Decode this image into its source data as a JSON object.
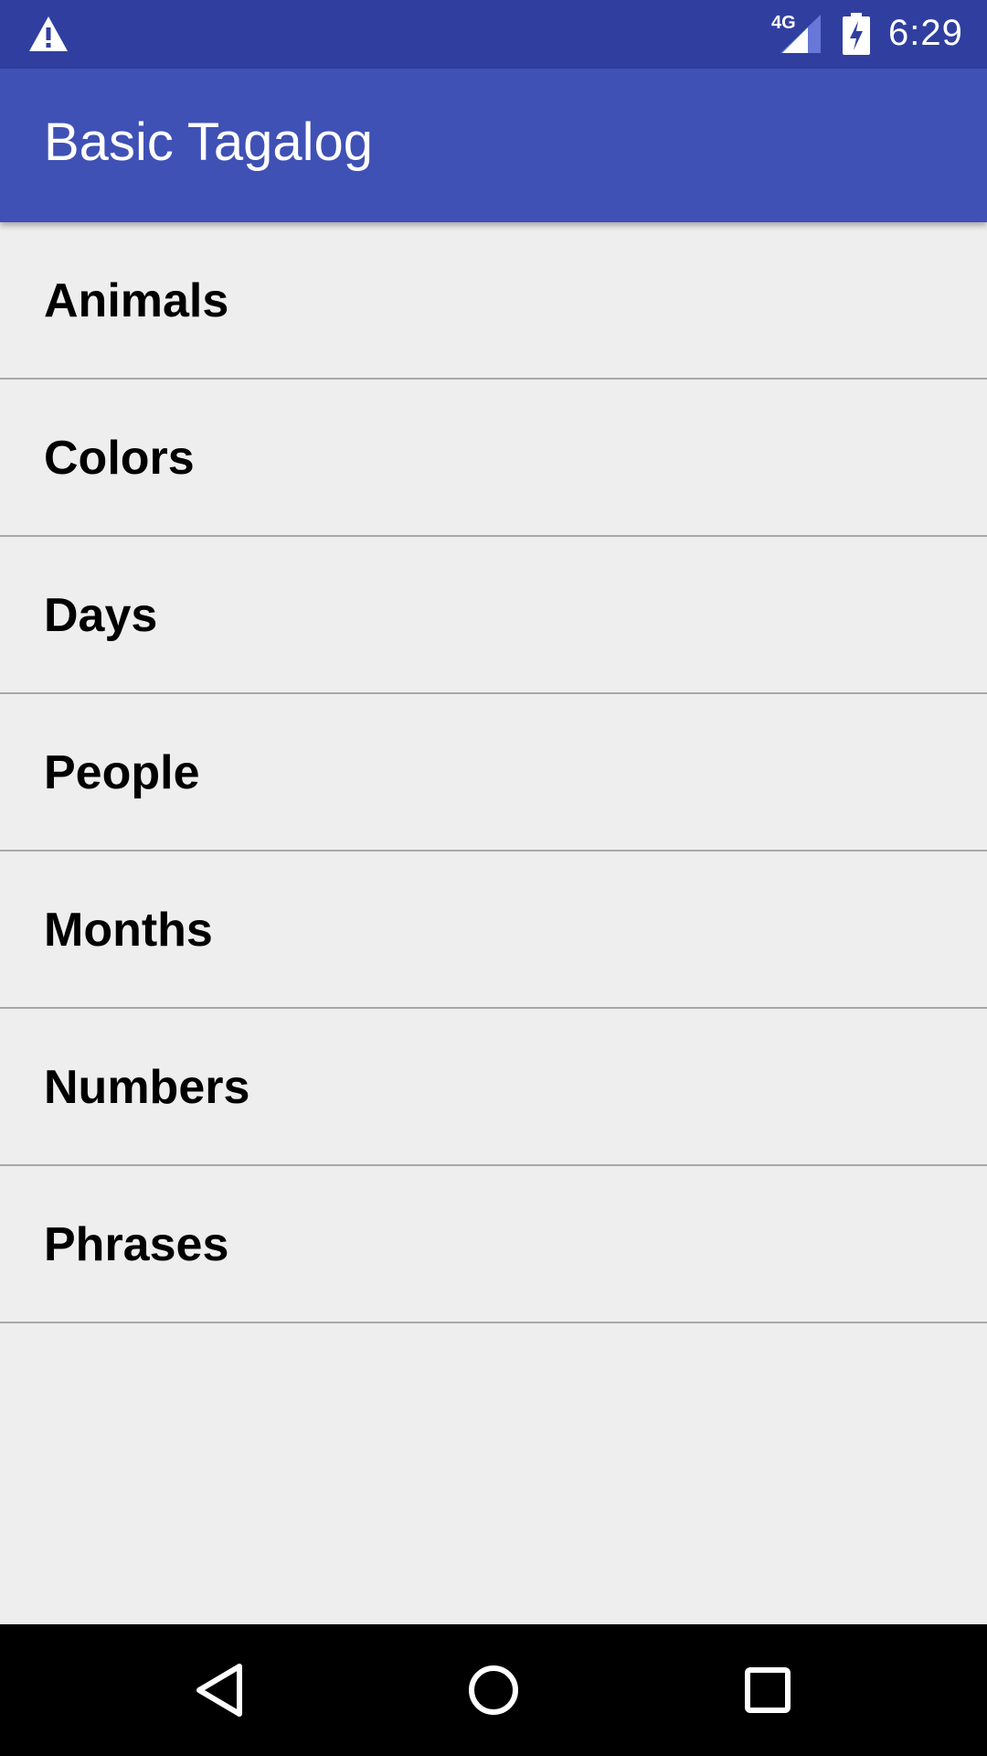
{
  "status_bar": {
    "warning_icon": "warning-icon",
    "network_type": "4G",
    "signal_icon": "cell-signal-icon",
    "battery_icon": "battery-charging-icon",
    "time": "6:29",
    "background_color": "#303f9f"
  },
  "app_bar": {
    "title": "Basic Tagalog",
    "background_color": "#3f51b5"
  },
  "categories": [
    {
      "label": "Animals"
    },
    {
      "label": "Colors"
    },
    {
      "label": "Days"
    },
    {
      "label": "People"
    },
    {
      "label": "Months"
    },
    {
      "label": "Numbers"
    },
    {
      "label": "Phrases"
    }
  ],
  "nav_bar": {
    "back_icon": "back-triangle-icon",
    "home_icon": "home-circle-icon",
    "recents_icon": "recents-square-icon"
  }
}
